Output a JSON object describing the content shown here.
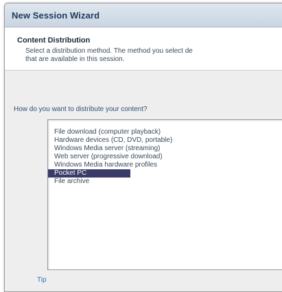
{
  "window": {
    "title": "New Session Wizard"
  },
  "header": {
    "title": "Content Distribution",
    "description_line1": "Select a distribution method. The method you select de",
    "description_line2": "that are available in this session."
  },
  "prompt": "How do you want to distribute your content?",
  "distribution_list": {
    "selected_index": 5,
    "items": [
      "File download (computer playback)",
      "Hardware devices (CD, DVD, portable)",
      "Windows Media server (streaming)",
      "Web server (progressive download)",
      "Windows Media hardware profiles",
      "Pocket PC",
      "File archive"
    ]
  },
  "tip_link": "Tip",
  "colors": {
    "selection": "#3b3b6a",
    "link": "#2e6fb5",
    "title_text": "#1e395b"
  }
}
